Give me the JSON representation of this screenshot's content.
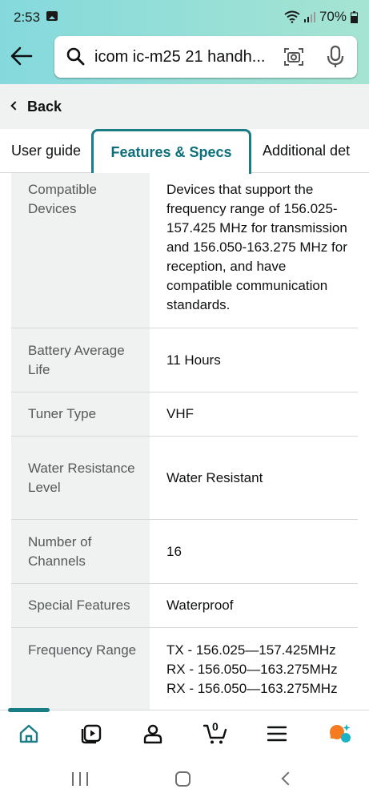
{
  "status_bar": {
    "time": "2:53",
    "battery": "70%",
    "icons": [
      "gallery-icon",
      "wifi-icon",
      "signal-icon",
      "battery-icon"
    ]
  },
  "search": {
    "query": "icom ic-m25 21 handh...",
    "icons": [
      "search-icon",
      "camera-icon",
      "microphone-icon"
    ]
  },
  "back": {
    "label": "Back"
  },
  "tabs": [
    {
      "label": "User guide",
      "active": false
    },
    {
      "label": "Features & Specs",
      "active": true
    },
    {
      "label": "Additional det",
      "active": false
    }
  ],
  "specs": [
    {
      "key": "Compatible Devices",
      "value": "Devices that support the frequency range of 156.025-157.425 MHz for transmission and 156.050-163.275 MHz for reception, and have compatible communication standards."
    },
    {
      "key": "Battery Average Life",
      "value": "11 Hours"
    },
    {
      "key": "Tuner Type",
      "value": "VHF"
    },
    {
      "key": "Water Resistance Level",
      "value": "Water Resistant"
    },
    {
      "key": "Number of Channels",
      "value": "16"
    },
    {
      "key": "Special Features",
      "value": "Waterproof"
    },
    {
      "key": "Frequency Range",
      "values": [
        "TX - 156.025—157.425MHz",
        "RX - 156.050—163.275MHz",
        "RX - 156.050—163.275MHz"
      ]
    }
  ],
  "bottom_nav": {
    "items": [
      "home-icon",
      "video-icon",
      "account-icon",
      "cart-icon",
      "menu-icon",
      "ai-assistant-icon"
    ],
    "cart_count": "0",
    "accent": "#1a7d86"
  },
  "colors": {
    "header_start": "#85d9dd",
    "header_end": "#a5e4d2",
    "active_tab": "#0d6f79",
    "ai_orange": "#f47b20",
    "ai_teal": "#1ab2c4"
  }
}
